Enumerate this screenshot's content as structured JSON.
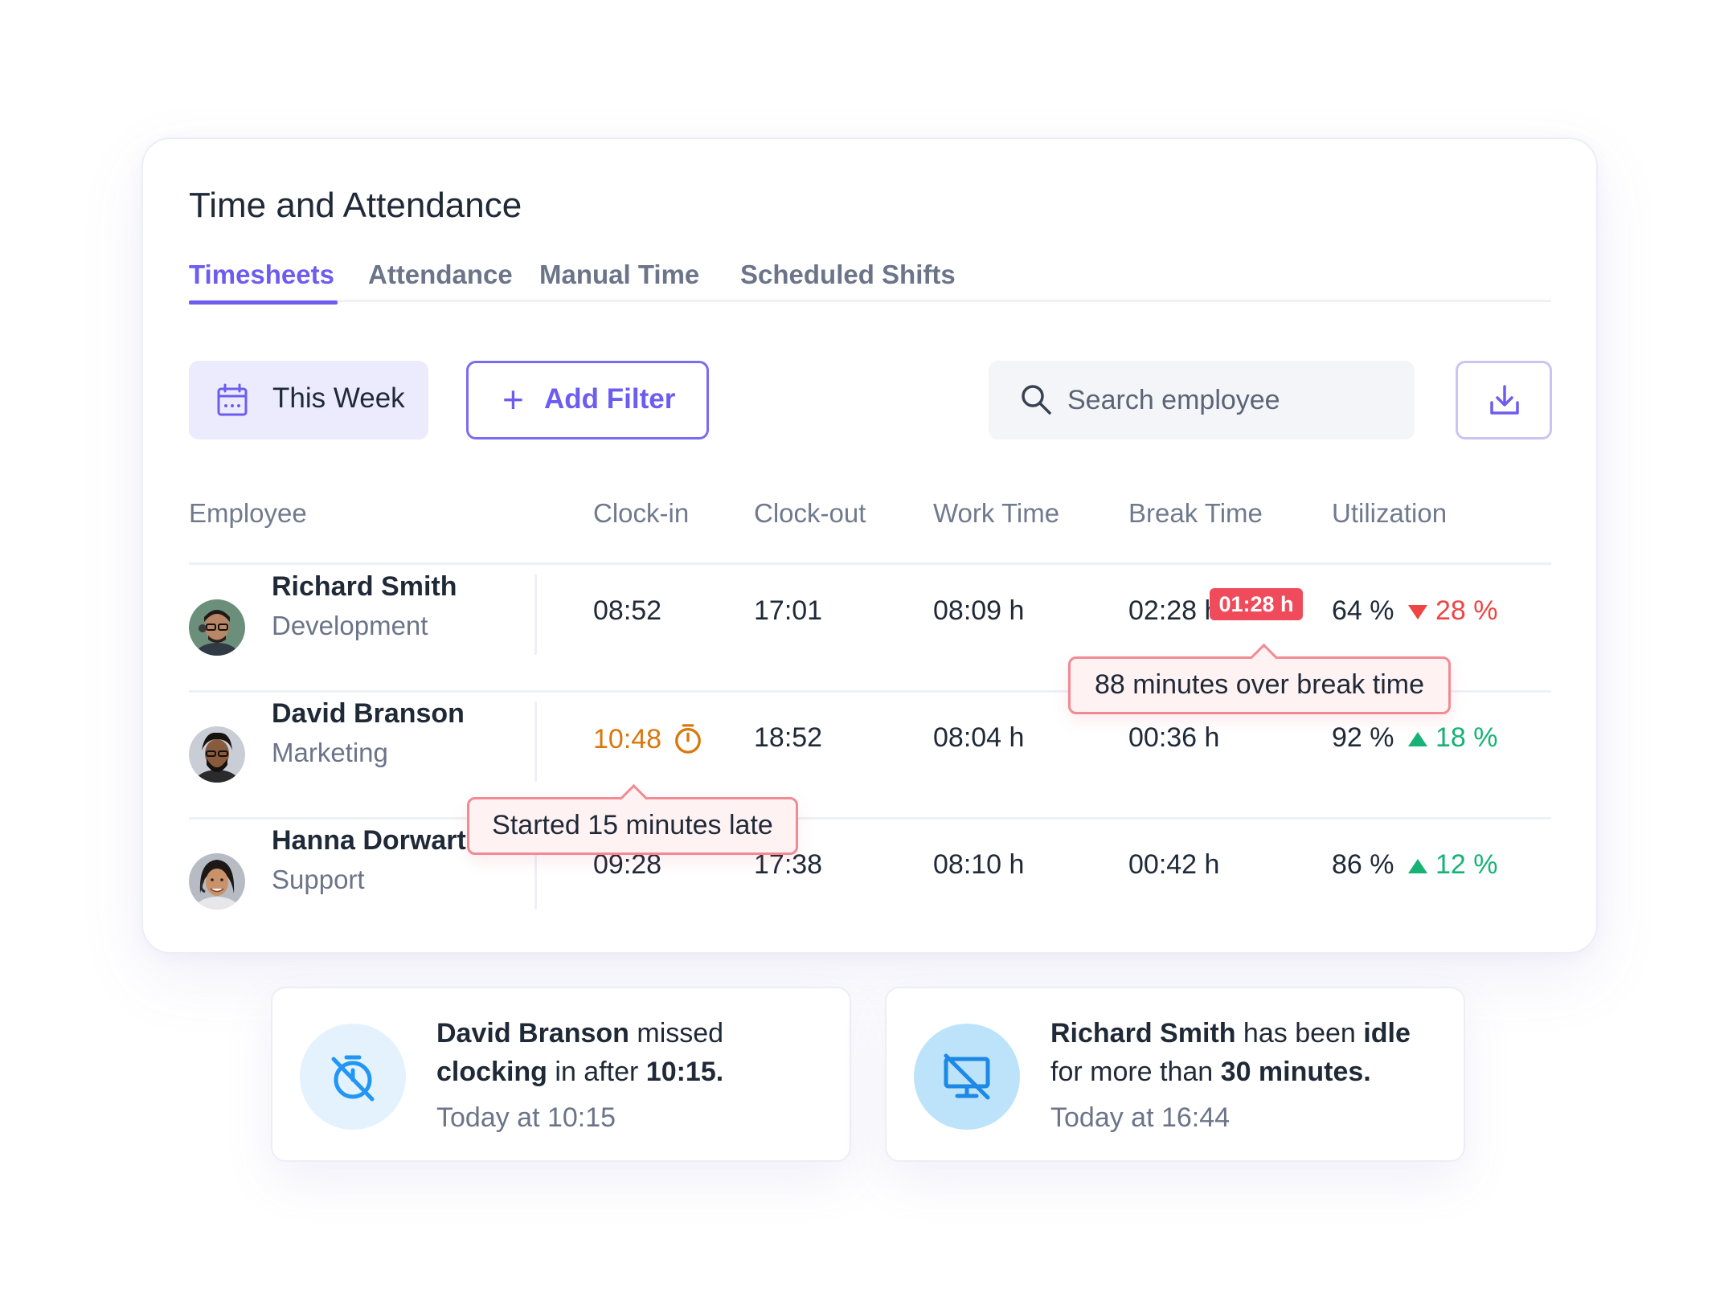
{
  "app": {
    "title": "Time and Attendance"
  },
  "tabs": [
    {
      "label": "Timesheets",
      "active": true
    },
    {
      "label": "Attendance",
      "active": false
    },
    {
      "label": "Manual Time",
      "active": false
    },
    {
      "label": "Scheduled Shifts",
      "active": false
    }
  ],
  "toolbar": {
    "date_range_label": "This Week",
    "date_range_icon": "calendar-icon",
    "add_filter_label": "Add Filter",
    "search_placeholder": "Search employee",
    "search_value": "",
    "download_icon": "download-icon"
  },
  "table": {
    "headers": [
      "Employee",
      "Clock-in",
      "Clock-out",
      "Work Time",
      "Break Time",
      "Utilization"
    ],
    "rows": [
      {
        "name": "Richard Smith",
        "department": "Development",
        "clock_in": "08:52",
        "clock_out": "17:01",
        "work_time": "08:09 h",
        "break_time": "02:28 h",
        "utilization": "64 %",
        "change": "28 %",
        "trend": "down"
      },
      {
        "name": "David Branson",
        "department": "Marketing",
        "clock_in": "10:48",
        "clock_out": "18:52",
        "work_time": "08:04 h",
        "break_time": "00:36 h",
        "utilization": "92 %",
        "change": "18 %",
        "trend": "up"
      },
      {
        "name": "Hanna Dorwart",
        "department": "Support",
        "clock_in": "09:28",
        "clock_out": "17:38",
        "work_time": "08:10 h",
        "break_time": "00:42 h",
        "utilization": "86 %",
        "change": "12 %",
        "trend": "up"
      }
    ]
  },
  "alerts": {
    "overtime_badge": "01:28 h",
    "break_tooltip": "88 minutes over break time",
    "late_tooltip": "Started 15 minutes late"
  },
  "notifications": [
    {
      "icon": "timer-off-icon",
      "name": "David Branson",
      "text_1": " missed ",
      "emphasis_1": "clocking",
      "text_2": " in after ",
      "emphasis_2": "10:15.",
      "time": "Today at 10:15",
      "circle_color": "#e3f2fd",
      "icon_color": "#2196f3"
    },
    {
      "icon": "monitor-off-icon",
      "name": "Richard Smith",
      "text_1": " has been ",
      "emphasis_1": "idle",
      "text_2": " for more than ",
      "emphasis_2": "30 minutes.",
      "time": "Today at 16:44",
      "circle_color": "#bde3fb",
      "icon_color": "#1e88e5"
    }
  ],
  "colors": {
    "accent": "#6d5cf0",
    "danger": "#ef4b5b",
    "success": "#16b374",
    "warning": "#d9770b"
  }
}
